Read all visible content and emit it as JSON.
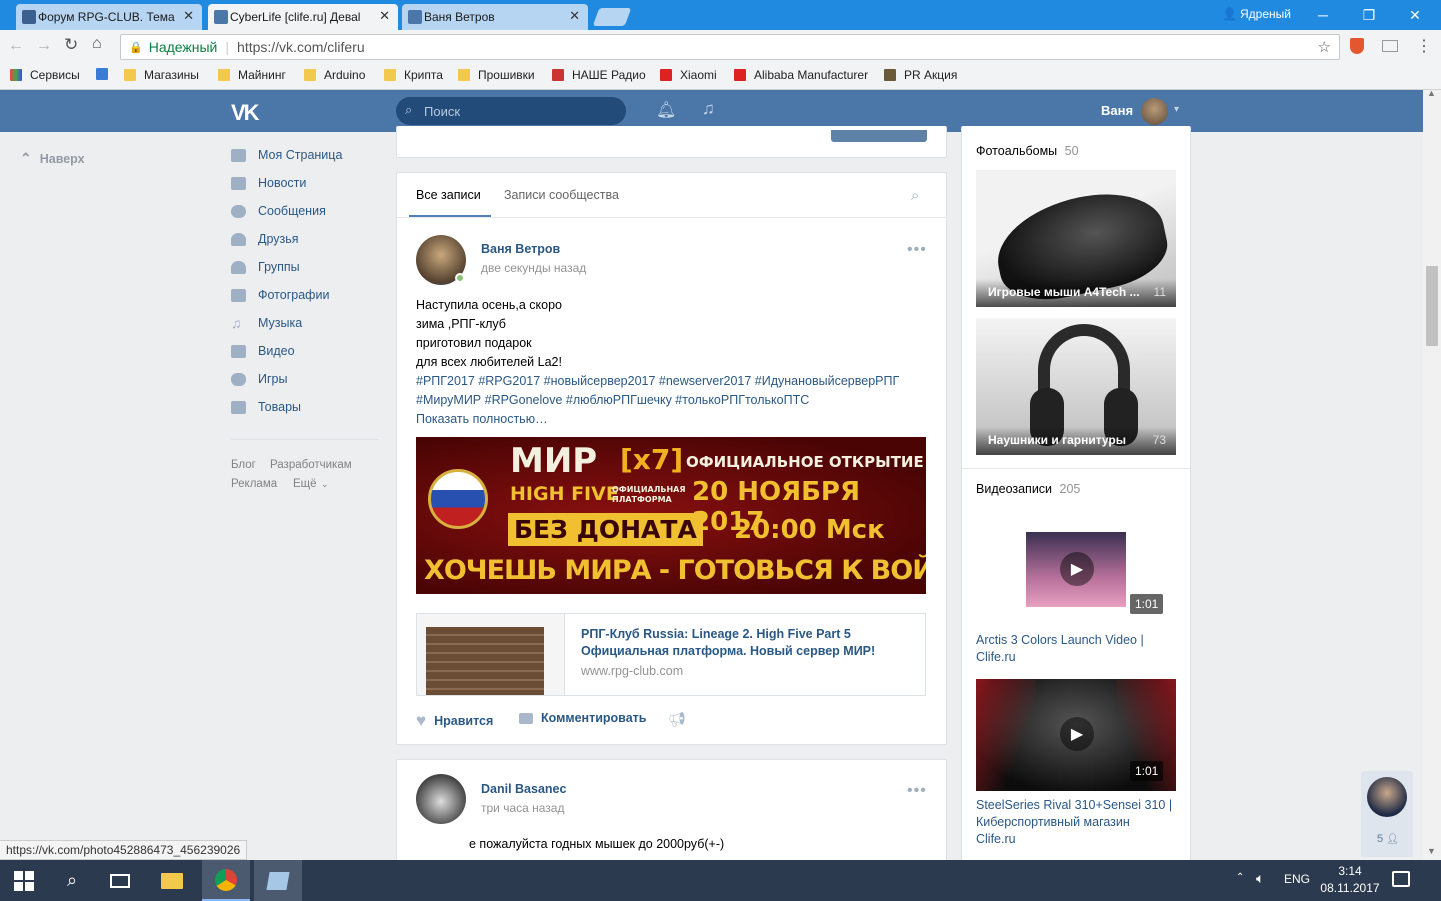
{
  "browser": {
    "tabs": [
      {
        "title": "Форум RPG-CLUB. Тема",
        "active": false
      },
      {
        "title": "CyberLife [clife.ru] Деваl",
        "active": true
      },
      {
        "title": "Ваня Ветров",
        "active": false
      }
    ],
    "profile_name": "Ядреный",
    "secure_label": "Надежный",
    "url": "https://vk.com/cliferu",
    "bookmarks": [
      "Сервисы",
      "Магазины",
      "Майнинг",
      "Arduino",
      "Крипта",
      "Прошивки",
      "НАШЕ Радио",
      "Xiaomi",
      "Alibaba Manufacturer",
      "PR Акция"
    ],
    "status_url": "https://vk.com/photo452886473_456239026"
  },
  "vk": {
    "search_placeholder": "Поиск",
    "user_name": "Ваня",
    "back_to_top": "Наверх",
    "menu": [
      {
        "label": "Моя Страница",
        "icon": "home-icon"
      },
      {
        "label": "Новости",
        "icon": "news-icon"
      },
      {
        "label": "Сообщения",
        "icon": "messages-icon"
      },
      {
        "label": "Друзья",
        "icon": "friends-icon"
      },
      {
        "label": "Группы",
        "icon": "groups-icon"
      },
      {
        "label": "Фотографии",
        "icon": "camera-icon"
      },
      {
        "label": "Музыка",
        "icon": "music-icon"
      },
      {
        "label": "Видео",
        "icon": "video-icon"
      },
      {
        "label": "Игры",
        "icon": "gamepad-icon"
      },
      {
        "label": "Товары",
        "icon": "bag-icon"
      }
    ],
    "footer_links": [
      "Блог",
      "Разработчикам",
      "Реклама",
      "Ещё"
    ],
    "wall_tabs": [
      "Все записи",
      "Записи сообщества"
    ],
    "post1": {
      "author": "Ваня Ветров",
      "time": "две секунды назад",
      "lines": [
        "Наступила осень,а скоро",
        "зима ,РПГ-клуб",
        "приготовил подарок",
        "для всех любителей La2!"
      ],
      "hashtags1": "#РПГ2017 #RPG2017 #новыйсервер2017 #newserver2017 #ИдунановыйсерверРПГ",
      "hashtags2": "#МируМИР #RPGonelove #люблюРПГшечку #толькоРПГтолькоПТС",
      "show_more": "Показать полностью…",
      "banner": {
        "title": "МИР",
        "rate": "[x7]",
        "high_five": "HIGH FIVE",
        "official_small": "ОФИЦИАЛЬНАЯ ПЛАТФОРМА",
        "no_donate": "БЕЗ ДОНАТА",
        "opening": "ОФИЦИАЛЬНОЕ ОТКРЫТИЕ",
        "date": "20 НОЯБРЯ 2017",
        "time": "20:00 Мск",
        "slogan": "ХОЧЕШЬ МИРА - ГОТОВЬСЯ К ВОЙНЕ"
      },
      "link_title_1": "РПГ-Клуб Russia: Lineage 2. High Five Part 5",
      "link_title_2": "Официальная платформа. Новый сервер МИР!",
      "link_domain": "www.rpg-club.com",
      "like_label": "Нравится",
      "comment_label": "Комментировать"
    },
    "post2": {
      "author": "Danil Basanec",
      "time": "три часа назад",
      "text": "е пожалуйста годных мышек до 2000руб(+-)"
    },
    "albums": {
      "title": "Фотоальбомы",
      "count": "50",
      "items": [
        {
          "name": "Игровые мыши A4Tech ...",
          "count": "11"
        },
        {
          "name": "Наушники и гарнитуры",
          "count": "73"
        }
      ]
    },
    "videos": {
      "title": "Видеозаписи",
      "count": "205",
      "items": [
        {
          "duration": "1:01",
          "title_1": "Arctis 3 Colors Launch Video |",
          "title_2": "Clife.ru"
        },
        {
          "duration": "1:01",
          "title_1": "SteelSeries Rival 310+Sensei 310 |",
          "title_2": "Киберспортивный магазин",
          "title_3": "Clife.ru"
        }
      ]
    },
    "chat_count": "5"
  },
  "taskbar": {
    "lang": "ENG",
    "time": "3:14",
    "date": "08.11.2017"
  }
}
